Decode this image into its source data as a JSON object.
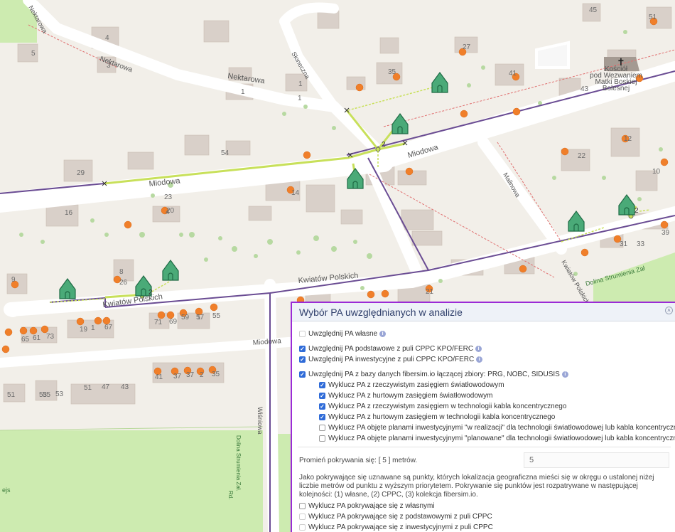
{
  "map": {
    "streets": {
      "miodowa_main": "Miodowa",
      "miodowa_east": "Miodowa",
      "nektarowa_west": "Nektarowa",
      "nektarowa_mid": "Nektarowa",
      "nektarowa_top": "Nektarowa",
      "sloneczna": "Słoneczna",
      "kwiatow_east": "Kwiatów Polskich",
      "kwiatow_west": "Kwiatów Polskich",
      "kwiatow_se": "Kwiatów Polskich",
      "malinowa": "Malinowa",
      "miodowa_vertical": "Miodowa",
      "wisniowa": "Wiśniowa",
      "dolina_strumienia_east": "Dolina Strumienia Zał",
      "dolina_strumienia_bottom": "Dolina Strumienia Zał.",
      "dolina_strumienia_bottom2": "Rd.",
      "ejs": "ejs"
    },
    "church_label": [
      "Kościół",
      "pod Wezwaniem",
      "Matki Boskiej",
      "Bolesnej"
    ],
    "house_numbers": [
      "4",
      "5",
      "3",
      "1",
      "27",
      "35",
      "41",
      "43",
      "45",
      "51",
      "54",
      "29",
      "23",
      "16",
      "14",
      "22",
      "12",
      "10",
      "9",
      "8",
      "26",
      "20",
      "19",
      "1",
      "67",
      "65",
      "61",
      "73",
      "71",
      "69",
      "59",
      "57",
      "55",
      "53",
      "51",
      "55",
      "53",
      "51",
      "47",
      "43",
      "41",
      "37",
      "37",
      "35",
      "31",
      "33",
      "21",
      "39",
      "4",
      "1",
      "2",
      "1",
      "1"
    ],
    "marker_labels": [
      "2",
      "2",
      "2"
    ],
    "colors": {
      "route": "#c8e05a",
      "cable": "#6a4c93",
      "point": "#f07f2a",
      "house_icon": "#3a9a6a",
      "panel_border": "#9b2bd6"
    }
  },
  "panel": {
    "title": "Wybór PA uwzględnianych w analizie",
    "collapse_icon": "chevron-up-icon",
    "options": [
      {
        "label": "Uwzględnij PA własne",
        "checked": false,
        "dim": true,
        "info": true,
        "indent": 0
      },
      {
        "label": "Uwzględnij PA podstawowe z puli CPPC KPO/FERC",
        "checked": true,
        "dim": false,
        "info": true,
        "indent": 0
      },
      {
        "label": "Uwzględnij PA inwestycyjne z puli CPPC KPO/FERC",
        "checked": true,
        "dim": false,
        "info": true,
        "indent": 0
      },
      {
        "label": "Uwzględnij PA z bazy danych fibersim.io łączącej zbiory: PRG, NOBC, SIDUSIS",
        "checked": true,
        "dim": false,
        "info": true,
        "indent": 0
      },
      {
        "label": "Wyklucz PA z rzeczywistym zasięgiem światłowodowym",
        "checked": true,
        "dim": false,
        "info": false,
        "indent": 1
      },
      {
        "label": "Wyklucz PA z hurtowym zasięgiem światłowodowym",
        "checked": true,
        "dim": false,
        "info": false,
        "indent": 1
      },
      {
        "label": "Wyklucz PA z rzeczywistym zasięgiem w technologii kabla koncentrycznego",
        "checked": true,
        "dim": false,
        "info": false,
        "indent": 1
      },
      {
        "label": "Wyklucz PA z hurtowym zasięgiem w technologii kabla koncentrycznego",
        "checked": true,
        "dim": false,
        "info": false,
        "indent": 1
      },
      {
        "label": "Wyklucz PA objęte planami inwestycyjnymi \"w realizacji\" dla technologii światłowodowej lub kabla koncentrycznego",
        "checked": false,
        "dim": false,
        "info": false,
        "indent": 1
      },
      {
        "label": "Wyklucz PA objęte planami inwestycyjnymi \"planowane\" dla technologii światłowodowej lub kabla koncentrycznego",
        "checked": false,
        "dim": false,
        "info": false,
        "indent": 1
      }
    ],
    "radius_label": "Promień pokrywania się: [ 5 ] metrów.",
    "radius_value": "5",
    "description": "Jako pokrywające się uznawane są punkty, których lokalizacja geograficzna mieści się w okręgu o ustalonej niżej liczbie metrów od punktu z wyższym priorytetem. Pokrywanie się punktów jest rozpatrywane w następującej kolejności: (1) własne, (2) CPPC, (3) kolekcja fibersim.io.",
    "exclude_options": [
      {
        "label": "Wyklucz PA pokrywające się z własnymi",
        "checked": false,
        "dim": false
      },
      {
        "label": "Wyklucz PA pokrywające się z podstawowymi z puli CPPC",
        "checked": false,
        "dim": true
      },
      {
        "label": "Wyklucz PA pokrywające się z inwestycyjnymi z puli CPPC",
        "checked": false,
        "dim": true
      }
    ]
  }
}
